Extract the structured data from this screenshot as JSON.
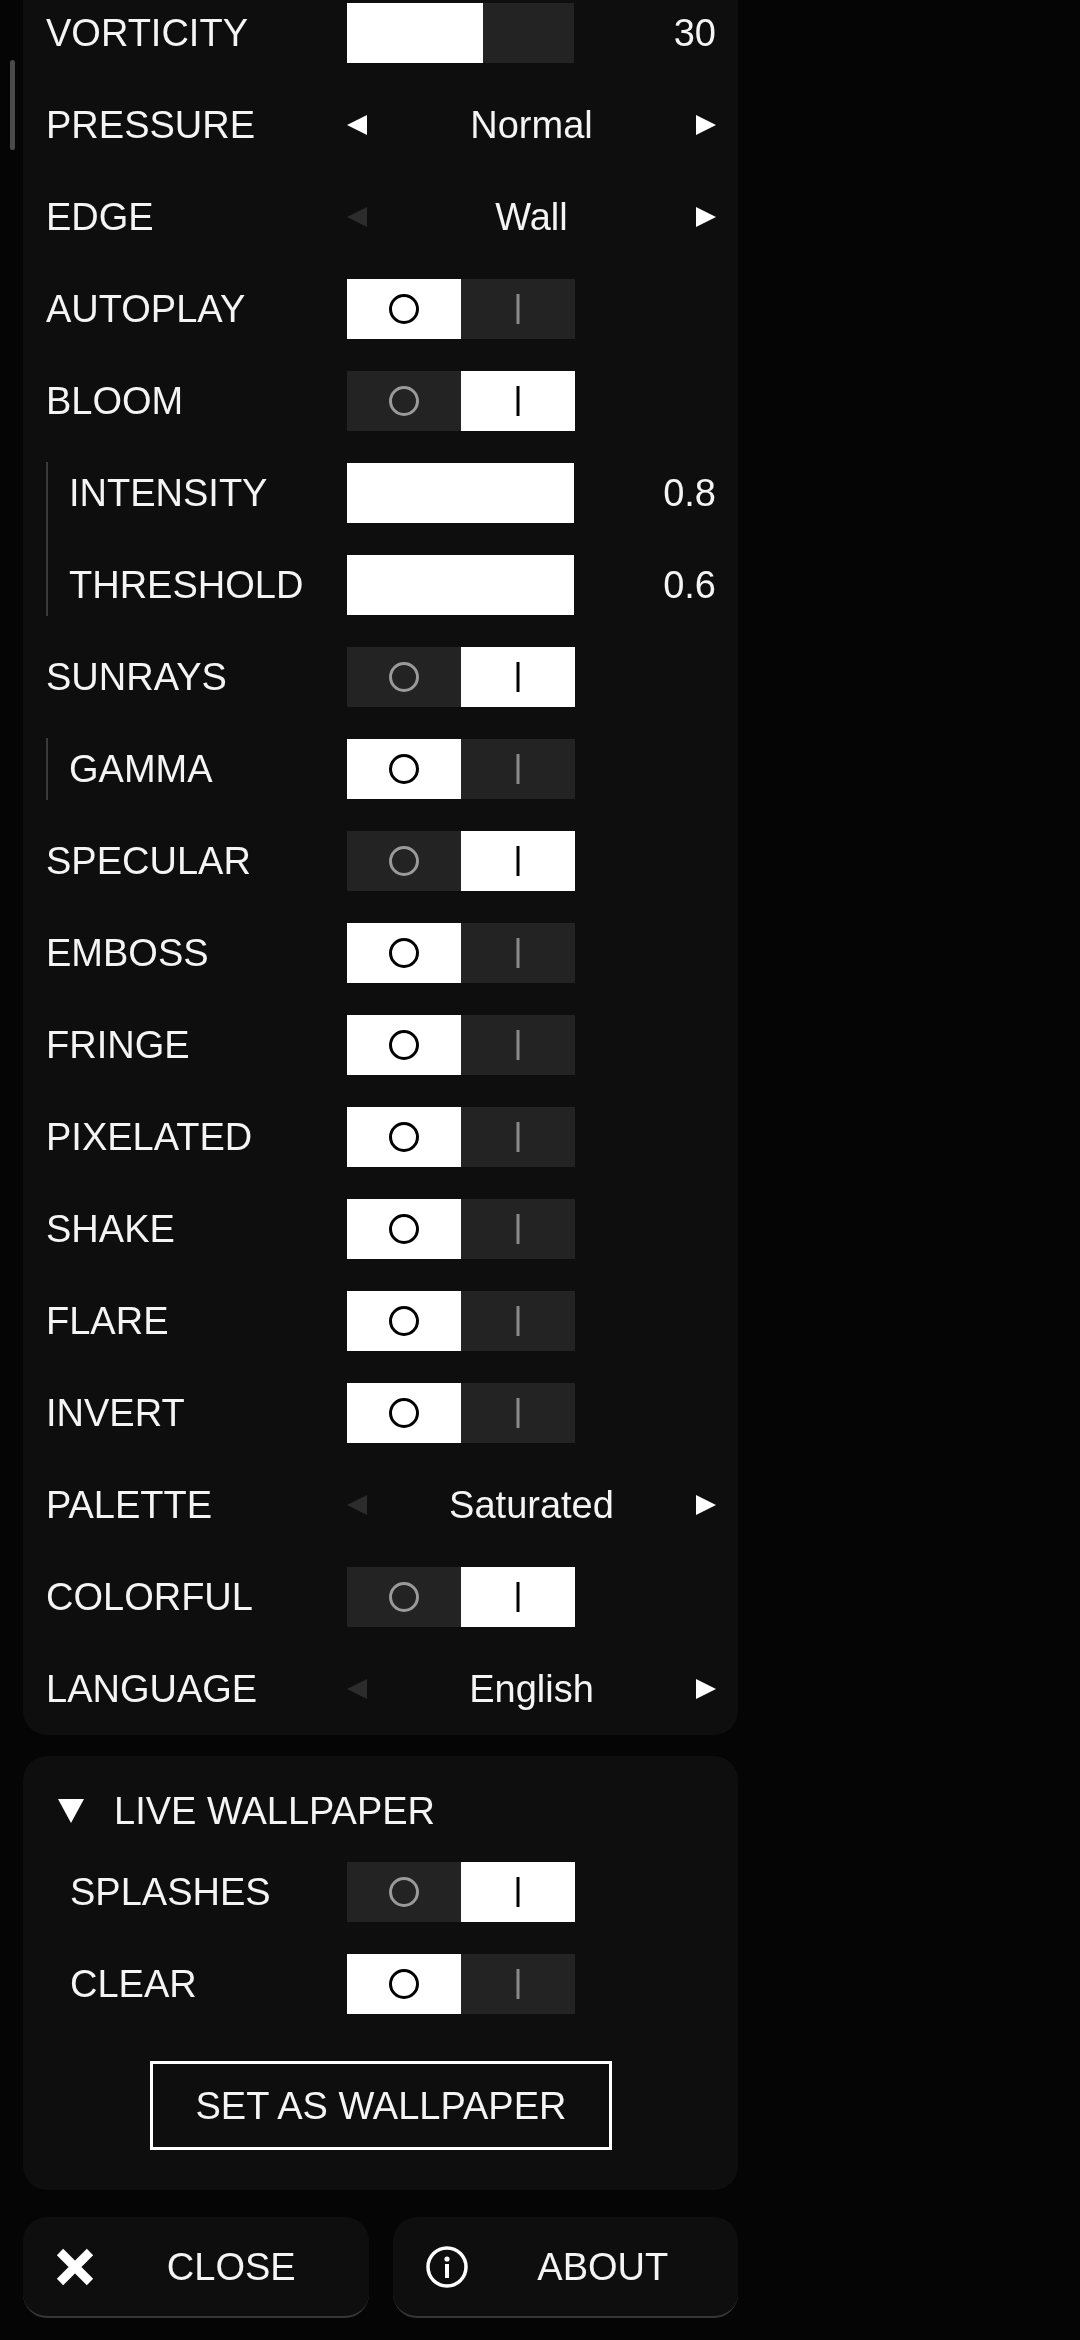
{
  "settings": {
    "items": [
      {
        "kind": "slider",
        "label": "VORTICITY",
        "level": 0.6,
        "value": "30"
      },
      {
        "kind": "selector",
        "label": "PRESSURE",
        "value": "Normal",
        "prev_disabled": false,
        "next_disabled": false
      },
      {
        "kind": "selector",
        "label": "EDGE",
        "value": "Wall",
        "prev_disabled": true,
        "next_disabled": false
      },
      {
        "kind": "toggle",
        "label": "AUTOPLAY",
        "on": false
      },
      {
        "kind": "toggle",
        "label": "BLOOM",
        "on": true,
        "children": [
          {
            "kind": "slider",
            "label": "INTENSITY",
            "level": 1,
            "value": "0.8"
          },
          {
            "kind": "slider",
            "label": "THRESHOLD",
            "level": 1,
            "value": "0.6"
          }
        ]
      },
      {
        "kind": "toggle",
        "label": "SUNRAYS",
        "on": true,
        "children": [
          {
            "kind": "toggle",
            "label": "GAMMA",
            "on": false
          }
        ]
      },
      {
        "kind": "toggle",
        "label": "SPECULAR",
        "on": true
      },
      {
        "kind": "toggle",
        "label": "EMBOSS",
        "on": false
      },
      {
        "kind": "toggle",
        "label": "FRINGE",
        "on": false
      },
      {
        "kind": "toggle",
        "label": "PIXELATED",
        "on": false
      },
      {
        "kind": "toggle",
        "label": "SHAKE",
        "on": false
      },
      {
        "kind": "toggle",
        "label": "FLARE",
        "on": false
      },
      {
        "kind": "toggle",
        "label": "INVERT",
        "on": false
      },
      {
        "kind": "selector",
        "label": "PALETTE",
        "value": "Saturated",
        "prev_disabled": true,
        "next_disabled": false
      },
      {
        "kind": "toggle",
        "label": "COLORFUL",
        "on": true
      },
      {
        "kind": "selector",
        "label": "LANGUAGE",
        "value": "English",
        "prev_disabled": true,
        "next_disabled": false
      }
    ]
  },
  "live_wallpaper": {
    "title": "LIVE WALLPAPER",
    "expanded": true,
    "items": [
      {
        "kind": "toggle",
        "label": "SPLASHES",
        "on": true
      },
      {
        "kind": "toggle",
        "label": "CLEAR",
        "on": false
      }
    ],
    "button": "SET AS WALLPAPER"
  },
  "footer_buttons": [
    {
      "kind": "close",
      "label": "CLOSE"
    },
    {
      "kind": "about",
      "label": "ABOUT"
    }
  ]
}
